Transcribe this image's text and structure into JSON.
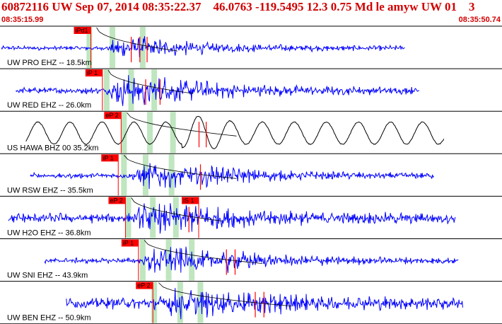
{
  "header": {
    "event_line": "60872116 UW Sep 07, 2014 08:35:22.37    46.0763 -119.5495 12.3 0.75 Md le amyw UW 01    3",
    "start_time": "08:35:15.99",
    "end_time": "08:35:50.74"
  },
  "colors": {
    "header_text": "#d00000",
    "trace_short_period": "#0000ff",
    "trace_broadband": "#000000",
    "pick_flag": "#ff0000",
    "pick_window": "#bfe6bf",
    "moveout_curve": "#000000",
    "separator": "#000000"
  },
  "traces": [
    {
      "label": "UW PRO EHZ -- 18.5km",
      "color": "blue",
      "trace_start_s": 0.0,
      "trace_end_s": 28.0,
      "p_pick": "iPd1",
      "p_pick_time_s": 6.2,
      "amp": 0.12,
      "onset_s": 7.3,
      "peak_amp": 0.55,
      "freq": 6.5,
      "s_arrival_s": 9.7,
      "green_bands_s": [
        5.9,
        7.5,
        9.6
      ],
      "extra_red_ticks_s": [
        9.0,
        9.6,
        10.1
      ]
    },
    {
      "label": "UW RED EHZ -- 26.0km",
      "color": "blue",
      "trace_start_s": 1.0,
      "trace_end_s": 29.0,
      "p_pick": "iP 1",
      "p_pick_time_s": 7.0,
      "amp": 0.18,
      "onset_s": 7.3,
      "peak_amp": 0.85,
      "freq": 6.5,
      "s_arrival_s": 10.8,
      "green_bands_s": [
        7.1,
        8.8,
        10.4
      ],
      "extra_red_ticks_s": [
        10.0,
        11.0
      ]
    },
    {
      "label": "US HAWA BHZ 00 35.2km",
      "color": "black",
      "trace_start_s": 1.7,
      "trace_end_s": 30.7,
      "p_pick": "eP 2",
      "p_pick_time_s": 8.3,
      "amp": 0.55,
      "onset_s": 12.5,
      "peak_amp": 0.85,
      "freq": 0.45,
      "s_arrival_s": 13.8,
      "green_bands_s": [
        8.3,
        10.1,
        11.7
      ],
      "extra_red_ticks_s": [
        13.7,
        14.2
      ]
    },
    {
      "label": "UW RSW EHZ -- 35.5km",
      "color": "blue",
      "trace_start_s": 2.0,
      "trace_end_s": 30.0,
      "p_pick": "iP 1",
      "p_pick_time_s": 8.1,
      "amp": 0.15,
      "onset_s": 9.0,
      "peak_amp": 0.7,
      "freq": 7.0,
      "s_arrival_s": 13.8,
      "green_bands_s": [
        8.3,
        9.8,
        11.6
      ],
      "extra_red_ticks_s": [
        13.8
      ]
    },
    {
      "label": "UW H2O EHZ -- 36.8km",
      "color": "blue",
      "trace_start_s": 0.5,
      "trace_end_s": 31.5,
      "p_pick": "eP 2",
      "p_pick_time_s": 8.6,
      "amp": 0.28,
      "onset_s": 9.2,
      "peak_amp": 0.8,
      "freq": 6.5,
      "s_arrival_s": 12.8,
      "green_bands_s": [
        8.6,
        10.3,
        11.9
      ],
      "s_pick": "iS 1",
      "s_pick_time_s": 12.5,
      "extra_red_ticks_s": [
        13.0
      ]
    },
    {
      "label": "UW SNI EHZ -- 43.9km",
      "color": "blue",
      "trace_start_s": 3.0,
      "trace_end_s": 31.7,
      "p_pick": "iP 1",
      "p_pick_time_s": 9.5,
      "amp": 0.15,
      "onset_s": 9.8,
      "peak_amp": 0.8,
      "freq": 6.5,
      "s_arrival_s": 15.6,
      "green_bands_s": [
        9.6,
        11.4,
        13.0
      ],
      "extra_red_ticks_s": [
        15.6,
        16.2
      ]
    },
    {
      "label": "UW BEN EHZ -- 50.9km",
      "color": "blue",
      "trace_start_s": 4.5,
      "trace_end_s": 32.0,
      "p_pick": "eP 2",
      "p_pick_time_s": 10.5,
      "amp": 0.32,
      "onset_s": 10.9,
      "peak_amp": 0.85,
      "freq": 6.5,
      "s_arrival_s": 17.6,
      "green_bands_s": [
        10.4,
        12.2,
        13.6
      ],
      "extra_red_ticks_s": [
        17.6,
        18.2
      ]
    }
  ]
}
